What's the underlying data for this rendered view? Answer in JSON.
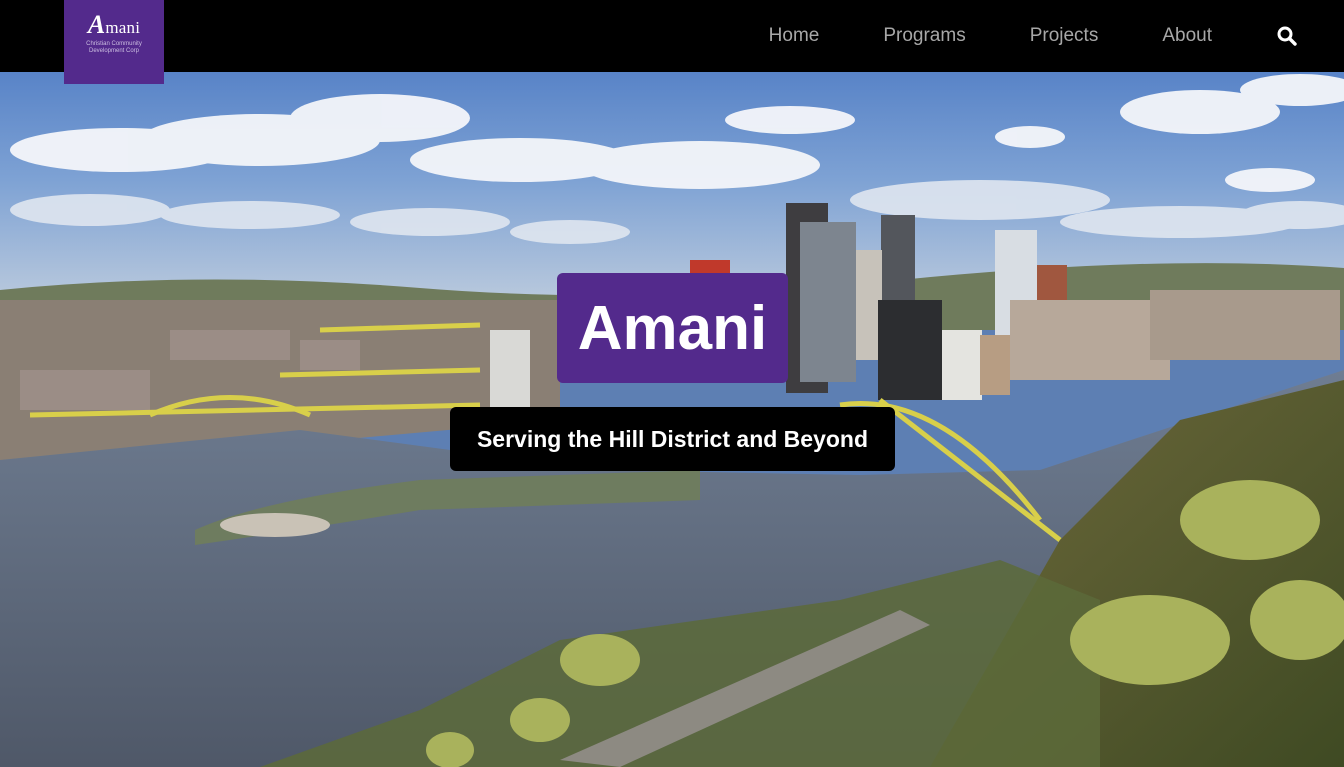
{
  "brand": {
    "logo_wordmark_initial": "A",
    "logo_wordmark_rest": "mani",
    "logo_subtitle": "Christian Community Development Corp",
    "color_primary": "#532a8c",
    "color_nav_bg": "#000000"
  },
  "nav": {
    "items": [
      {
        "label": "Home"
      },
      {
        "label": "Programs"
      },
      {
        "label": "Projects"
      },
      {
        "label": "About"
      }
    ],
    "search_icon": "search-icon"
  },
  "hero": {
    "title": "Amani",
    "tagline": "Serving the Hill District and Beyond",
    "background": "city-skyline-with-rivers-and-bridges-photo"
  }
}
